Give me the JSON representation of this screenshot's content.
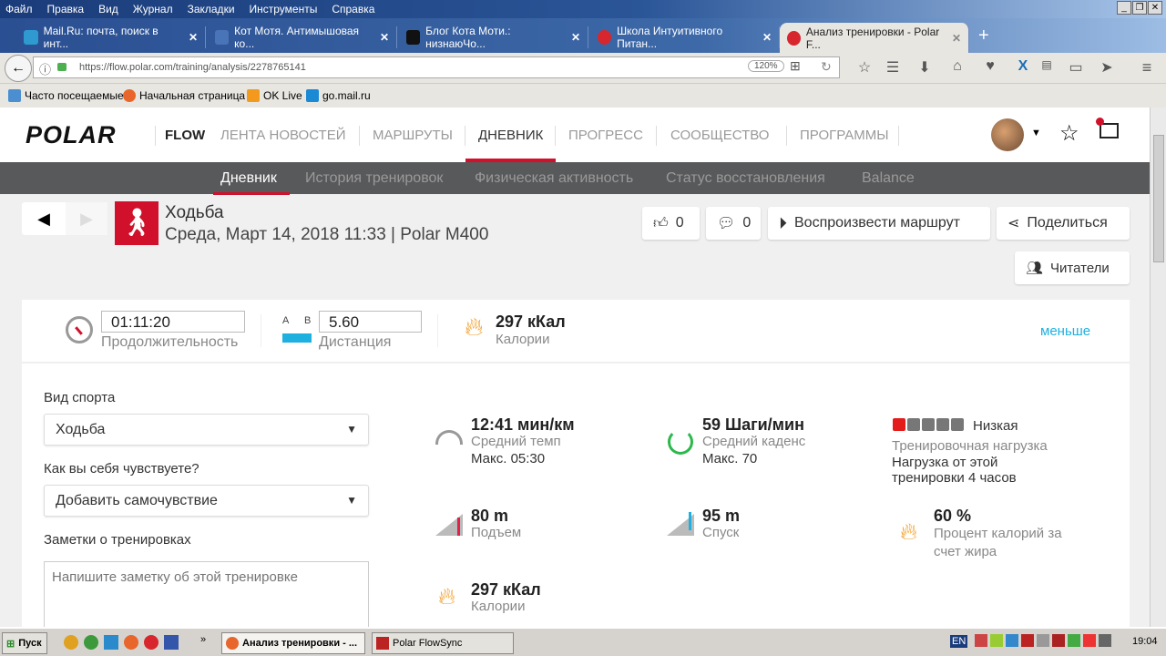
{
  "browser": {
    "menu": [
      "Файл",
      "Правка",
      "Вид",
      "Журнал",
      "Закладки",
      "Инструменты",
      "Справка"
    ],
    "tabs": [
      {
        "title": "Mail.Ru: почта, поиск в инт...",
        "color": "#2e9ad0"
      },
      {
        "title": "Кот Мотя. Антимышовая ко...",
        "color": "#4a74b8"
      },
      {
        "title": "Блог Кота Моти.: низнаюЧо...",
        "color": "#111111"
      },
      {
        "title": "Школа Интуитивного Питан...",
        "color": "#d7262e"
      },
      {
        "title": "Анализ тренировки - Polar F...",
        "color": "#d7262e"
      }
    ],
    "new_tab": "+",
    "url": "https://flow.polar.com/training/analysis/2278765141",
    "zoom": "120%",
    "bookmarks": [
      "Часто посещаемые",
      "Начальная страница",
      "OK Live",
      "go.mail.ru"
    ]
  },
  "site": {
    "logo": "POLAR",
    "flow": "FLOW",
    "nav": [
      "ЛЕНТА НОВОСТЕЙ",
      "МАРШРУТЫ",
      "ДНЕВНИК",
      "ПРОГРЕСС",
      "СООБЩЕСТВО",
      "ПРОГРАММЫ"
    ],
    "subnav": [
      "Дневник",
      "История тренировок",
      "Физическая активность",
      "Статус восстановления",
      "Balance"
    ]
  },
  "training": {
    "sport": "Ходьба",
    "date": "Среда, Март 14, 2018 11:33 | Polar M400",
    "likes": "0",
    "comments": "0",
    "replay": "Воспроизвести маршрут",
    "share": "Поделиться",
    "readers": "Читатели"
  },
  "summary": {
    "duration": "01:11:20",
    "duration_label": "Продолжительность",
    "a": "A",
    "b": "B",
    "distance": "5.60",
    "distance_label": "Дистанция",
    "calories": "297 кКал",
    "calories_label": "Калории",
    "less": "меньше"
  },
  "form": {
    "sport_label": "Вид спорта",
    "sport_value": "Ходьба",
    "feel_label": "Как вы себя чувствуете?",
    "feel_value": "Добавить самочувствие",
    "notes_label": "Заметки о тренировках",
    "notes_placeholder": "Напишите заметку об этой тренировке"
  },
  "stats": {
    "pace": "12:41 мин/км",
    "pace_label": "Средний темп",
    "pace_max": "Макс. 05:30",
    "cadence": "59 Шаги/мин",
    "cadence_label": "Средний каденс",
    "cadence_max": "Макс. 70",
    "load_level": "Низкая",
    "load_bars_filled": 1,
    "load_bars_total": 5,
    "load_label": "Тренировочная нагрузка",
    "load_text": "Нагрузка от этой тренировки 4 часов",
    "ascent": "80 m",
    "ascent_label": "Подъем",
    "descent": "95 m",
    "descent_label": "Спуск",
    "fat": "60 %",
    "fat_label": "Процент калорий за счет жира",
    "calories": "297 кКал",
    "calories_label": "Калории"
  },
  "taskbar": {
    "start": "Пуск",
    "tasks": [
      "Анализ тренировки - ...",
      "Polar FlowSync"
    ],
    "lang": "EN",
    "time": "19:04"
  },
  "colors": {
    "accent": "#d1102b",
    "link": "#1eb1e0"
  }
}
